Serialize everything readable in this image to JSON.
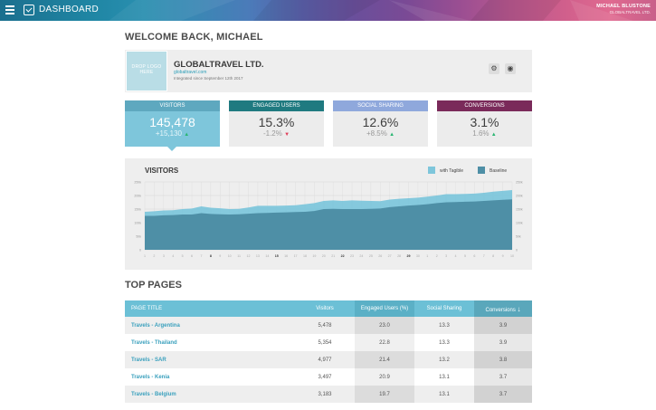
{
  "topbar": {
    "title": "DASHBOARD",
    "user_name": "MICHAEL BLUSTONE",
    "user_company": "GLOBALTRAVEL LTD."
  },
  "welcome": "WELCOME BACK, MICHAEL",
  "company": {
    "logo_placeholder": "DROP LOGO HERE",
    "name": "GLOBALTRAVEL LTD.",
    "url": "globaltravel.com",
    "since": "Integrated since September 12th 2017"
  },
  "kpis": [
    {
      "label": "VISITORS",
      "value": "145,478",
      "delta": "+15,130",
      "dir": "up",
      "color": "#5ea8bf"
    },
    {
      "label": "ENGAGED USERS",
      "value": "15.3%",
      "delta": "-1.2%",
      "dir": "down",
      "color": "#1f7a80"
    },
    {
      "label": "SOCIAL SHARING",
      "value": "12.6%",
      "delta": "+8.5%",
      "dir": "up",
      "color": "#8fa8dc"
    },
    {
      "label": "CONVERSIONS",
      "value": "3.1%",
      "delta": "1.6%",
      "dir": "up",
      "color": "#7a2a5a"
    }
  ],
  "chart_data": {
    "type": "area",
    "title": "VISITORS",
    "series": [
      {
        "name": "with Tagible",
        "color": "#7ec6db",
        "values": [
          140,
          142,
          145,
          146,
          150,
          152,
          160,
          155,
          153,
          150,
          151,
          156,
          162,
          162,
          162,
          163,
          164,
          168,
          172,
          180,
          182,
          180,
          182,
          181,
          180,
          179,
          185,
          188,
          190,
          192,
          196,
          200,
          205,
          205,
          206,
          207,
          210,
          214,
          217,
          220
        ]
      },
      {
        "name": "Baseline",
        "color": "#4e8fa6",
        "values": [
          125,
          125,
          127,
          128,
          130,
          130,
          135,
          132,
          131,
          130,
          131,
          133,
          135,
          136,
          137,
          138,
          139,
          140,
          143,
          150,
          151,
          150,
          150,
          150,
          151,
          152,
          157,
          160,
          163,
          165,
          168,
          172,
          175,
          176,
          177,
          178,
          180,
          182,
          184,
          186
        ]
      }
    ],
    "yticks": [
      "250k",
      "200k",
      "150k",
      "100k",
      "50k",
      "0"
    ],
    "ylim": [
      0,
      250
    ],
    "x": [
      "1",
      "2",
      "3",
      "4",
      "5",
      "6",
      "7",
      "8",
      "9",
      "10",
      "11",
      "12",
      "13",
      "14",
      "15",
      "16",
      "17",
      "18",
      "19",
      "20",
      "21",
      "22",
      "23",
      "24",
      "25",
      "26",
      "27",
      "28",
      "29",
      "30",
      "1",
      "2",
      "3",
      "4",
      "5",
      "6",
      "7",
      "8",
      "9",
      "10"
    ],
    "xticks": [
      "1",
      "2",
      "3",
      "4",
      "5",
      "6",
      "7",
      "8",
      "9",
      "10",
      "11",
      "12",
      "13",
      "14",
      "15",
      "16",
      "17",
      "18",
      "19",
      "20",
      "21",
      "22",
      "23",
      "24",
      "25",
      "26",
      "27",
      "28",
      "29",
      "30",
      "1",
      "2",
      "3",
      "4",
      "5",
      "6",
      "7",
      "8",
      "9",
      "10",
      "11",
      "12",
      "13",
      "14",
      "15",
      "16",
      "17",
      "18",
      "19",
      "20",
      "21",
      "22",
      "23",
      "24",
      "25",
      "26",
      "27",
      "28",
      "29",
      "30",
      "1",
      "2",
      "3",
      "4",
      "5",
      "6",
      "7",
      "8",
      "9",
      "10",
      "11",
      "12",
      "13",
      "14",
      "15",
      "16",
      "17",
      "18",
      "19",
      "20",
      "21",
      "22",
      "23",
      "24",
      "25",
      "26",
      "27",
      "28",
      "29",
      "30",
      "1",
      "2",
      "3",
      "4",
      "5",
      "6",
      "7",
      "8",
      "9",
      "10",
      "11",
      "12",
      "13",
      "14",
      "15",
      "16",
      "17",
      "18",
      "19",
      "20",
      "21",
      "22",
      "23",
      "24",
      "25",
      "26",
      "27",
      "28",
      "29",
      "30",
      "1",
      "2",
      "3",
      "4",
      "5",
      "6",
      "7",
      "8",
      "9",
      "10",
      "11",
      "12",
      "13",
      "14",
      "15",
      "16",
      "17",
      "18",
      "19",
      "20",
      "21",
      "22",
      "23",
      "24",
      "25",
      "26",
      "27",
      "28",
      "29",
      "30",
      "1",
      "2",
      "3",
      "4",
      "5",
      "6",
      "7",
      "8",
      "9",
      "10",
      "11",
      "12",
      "13",
      "14",
      "15",
      "16",
      "17",
      "18",
      "19",
      "20",
      "21",
      "22",
      "23",
      "24",
      "25",
      "26",
      "27",
      "28",
      "29",
      "30",
      "1",
      "2",
      "3",
      "4",
      "5",
      "6",
      "7",
      "8",
      "9",
      "10",
      "11",
      "12",
      "13",
      "14",
      "15",
      "16",
      "17",
      "18",
      "19",
      "20",
      "21",
      "22",
      "23",
      "24",
      "25",
      "26",
      "27",
      "28",
      "29",
      "30",
      "1",
      "2",
      "3",
      "4",
      "5",
      "6",
      "7",
      "8",
      "9",
      "10",
      "11",
      "12",
      "13",
      "14",
      "15",
      "16",
      "17",
      "18",
      "19",
      "20",
      "21",
      "22",
      "23",
      "24",
      "25",
      "26",
      "27",
      "28",
      "29",
      "30",
      "1",
      "2",
      "3",
      "4",
      "5",
      "6",
      "7",
      "8",
      "9",
      "10",
      "11",
      "12",
      "13",
      "14",
      "15",
      "16",
      "17",
      "18",
      "19",
      "20",
      "21",
      "22",
      "23",
      "24",
      "25",
      "26",
      "27",
      "28",
      "29",
      "30",
      "1",
      "2",
      "3",
      "4",
      "5",
      "6",
      "7",
      "8",
      "9",
      "10",
      "11",
      "12",
      "13",
      "14",
      "15",
      "16",
      "17",
      "18",
      "19",
      "20",
      "21",
      "22",
      "23",
      "24",
      "25",
      "26",
      "27",
      "28",
      "29",
      "30",
      "1",
      "2",
      "3",
      "4",
      "5",
      "6",
      "7",
      "8",
      "9",
      "10",
      "11",
      "12",
      "13",
      "14",
      "15",
      "16",
      "17",
      "18",
      "19",
      "20",
      "21",
      "22",
      "23",
      "24",
      "25",
      "26",
      "27",
      "28",
      "29",
      "30",
      "1",
      "2",
      "3",
      "4",
      "5",
      "6",
      "7",
      "8",
      "9",
      "10",
      "11",
      "12",
      "13",
      "14",
      "15",
      "16",
      "17",
      "18",
      "19",
      "20",
      "21",
      "22",
      "23",
      "24",
      "25",
      "26",
      "27",
      "28",
      "29",
      "30",
      "1",
      "2",
      "3",
      "4",
      "5",
      "6",
      "7",
      "8",
      "9",
      "10",
      "11",
      "12",
      "13",
      "14",
      "15",
      "16",
      "17",
      "18",
      "19",
      "20",
      "21",
      "22",
      "23",
      "24",
      "25",
      "26",
      "27",
      "28",
      "29",
      "30",
      "1",
      "2",
      "3",
      "4",
      "5",
      "6",
      "7",
      "8",
      "9",
      "10",
      "11",
      "12",
      "13",
      "14",
      "15",
      "16",
      "17",
      "18",
      "19",
      "20",
      "21",
      "22",
      "23",
      "24",
      "25",
      "26",
      "27",
      "28",
      "29",
      "30"
    ],
    "bold_ticks": [
      "8",
      "15",
      "22",
      "29"
    ],
    "grid": true,
    "legend": "top-right"
  },
  "top_pages": {
    "title": "TOP PAGES",
    "columns": [
      "PAGE TITLE",
      "Visitors",
      "Engaged Users (%)",
      "Social Sharing",
      "Conversions"
    ],
    "sort_icon": "arrow-down-icon",
    "rows": [
      [
        "Travels - Argentina",
        "5,478",
        "23.0",
        "13.3",
        "3.9"
      ],
      [
        "Travels - Thailand",
        "5,354",
        "22.8",
        "13.3",
        "3.9"
      ],
      [
        "Travels - SAR",
        "4,977",
        "21.4",
        "13.2",
        "3.8"
      ],
      [
        "Travels - Kenia",
        "3,497",
        "20.9",
        "13.1",
        "3.7"
      ],
      [
        "Travels - Belgium",
        "3,183",
        "19.7",
        "13.1",
        "3.7"
      ]
    ]
  }
}
